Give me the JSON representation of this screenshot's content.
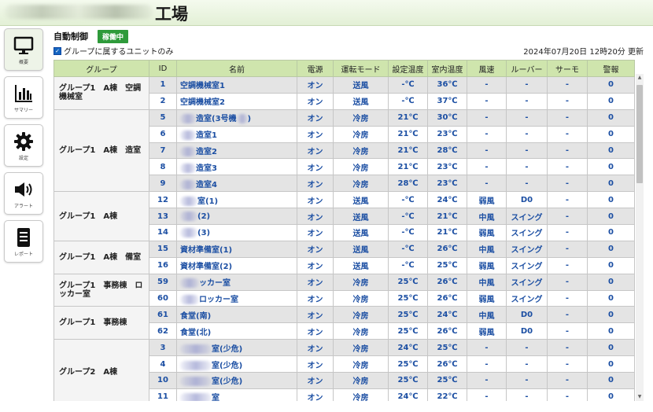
{
  "header": {
    "title": "工場"
  },
  "sidebar": [
    {
      "icon": "monitor-icon",
      "label": "概要"
    },
    {
      "icon": "bar-chart-icon",
      "label": "サマリー"
    },
    {
      "icon": "gear-icon",
      "label": "設定"
    },
    {
      "icon": "speaker-icon",
      "label": "アラート"
    },
    {
      "icon": "document-icon",
      "label": "レポート"
    }
  ],
  "page": {
    "title": "自動制御",
    "status": "稼働中",
    "filter_label": "グループに属するユニットのみ",
    "filter_checked": true,
    "updated": "2024年07月20日 12時20分 更新"
  },
  "columns": [
    "グループ",
    "ID",
    "名前",
    "電源",
    "運転モード",
    "設定温度",
    "室内温度",
    "風速",
    "ルーバー",
    "サーモ",
    "警報"
  ],
  "rows": [
    {
      "group": "グループ1　A棟　空調機械室",
      "span": 2,
      "id": "1",
      "name": "空調機械室1",
      "power": "オン",
      "mode": "送風",
      "set": "-℃",
      "room": "36℃",
      "fan": "-",
      "louver": "-",
      "thermo": "-",
      "alarm": "0"
    },
    {
      "id": "2",
      "name": "空調機械室2",
      "power": "オン",
      "mode": "送風",
      "set": "-℃",
      "room": "37℃",
      "fan": "-",
      "louver": "-",
      "thermo": "-",
      "alarm": "0"
    },
    {
      "group": "グループ1　A棟　造室",
      "span": 5,
      "id": "5",
      "name": "造室(3号機",
      "mask": 20,
      "tail": ")",
      "power": "オン",
      "mode": "冷房",
      "set": "21℃",
      "room": "30℃",
      "fan": "-",
      "louver": "-",
      "thermo": "-",
      "alarm": "0"
    },
    {
      "id": "6",
      "name": "造室1",
      "mask": 20,
      "power": "オン",
      "mode": "冷房",
      "set": "21℃",
      "room": "23℃",
      "fan": "-",
      "louver": "-",
      "thermo": "-",
      "alarm": "0"
    },
    {
      "id": "7",
      "name": "造室2",
      "mask": 20,
      "power": "オン",
      "mode": "冷房",
      "set": "21℃",
      "room": "28℃",
      "fan": "-",
      "louver": "-",
      "thermo": "-",
      "alarm": "0"
    },
    {
      "id": "8",
      "name": "造室3",
      "mask": 20,
      "power": "オン",
      "mode": "冷房",
      "set": "21℃",
      "room": "23℃",
      "fan": "-",
      "louver": "-",
      "thermo": "-",
      "alarm": "0"
    },
    {
      "id": "9",
      "name": "造室4",
      "mask": 20,
      "power": "オン",
      "mode": "冷房",
      "set": "28℃",
      "room": "23℃",
      "fan": "-",
      "louver": "-",
      "thermo": "-",
      "alarm": "0"
    },
    {
      "group": "グループ1　A棟",
      "span": 3,
      "id": "12",
      "name": "室(1)",
      "mask": 22,
      "power": "オン",
      "mode": "送風",
      "set": "-℃",
      "room": "24℃",
      "fan": "弱風",
      "louver": "D0",
      "thermo": "-",
      "alarm": "0"
    },
    {
      "id": "13",
      "name": "(2)",
      "mask": 22,
      "power": "オン",
      "mode": "送風",
      "set": "-℃",
      "room": "21℃",
      "fan": "中風",
      "louver": "スイング",
      "thermo": "-",
      "alarm": "0"
    },
    {
      "id": "14",
      "name": "(3)",
      "mask": 22,
      "power": "オン",
      "mode": "送風",
      "set": "-℃",
      "room": "21℃",
      "fan": "弱風",
      "louver": "スイング",
      "thermo": "-",
      "alarm": "0"
    },
    {
      "group": "グループ1　A棟　備室",
      "span": 2,
      "id": "15",
      "name": "資材準備室(1)",
      "power": "オン",
      "mode": "送風",
      "set": "-℃",
      "room": "26℃",
      "fan": "中風",
      "louver": "スイング",
      "thermo": "-",
      "alarm": "0"
    },
    {
      "id": "16",
      "name": "資材準備室(2)",
      "power": "オン",
      "mode": "送風",
      "set": "-℃",
      "room": "25℃",
      "fan": "弱風",
      "louver": "スイング",
      "thermo": "-",
      "alarm": "0"
    },
    {
      "group": "グループ1　事務棟　ロッカー室",
      "span": 2,
      "id": "59",
      "name": "ッカー室",
      "mask": 24,
      "power": "オン",
      "mode": "冷房",
      "set": "25℃",
      "room": "26℃",
      "fan": "中風",
      "louver": "スイング",
      "thermo": "-",
      "alarm": "0"
    },
    {
      "id": "60",
      "name": "ロッカー室",
      "mask": 24,
      "power": "オン",
      "mode": "冷房",
      "set": "25℃",
      "room": "26℃",
      "fan": "弱風",
      "louver": "スイング",
      "thermo": "-",
      "alarm": "0"
    },
    {
      "group": "グループ1　事務棟",
      "span": 2,
      "id": "61",
      "name": "食堂(南)",
      "power": "オン",
      "mode": "冷房",
      "set": "25℃",
      "room": "24℃",
      "fan": "中風",
      "louver": "D0",
      "thermo": "-",
      "alarm": "0"
    },
    {
      "id": "62",
      "name": "食堂(北)",
      "power": "オン",
      "mode": "冷房",
      "set": "25℃",
      "room": "26℃",
      "fan": "弱風",
      "louver": "D0",
      "thermo": "-",
      "alarm": "0"
    },
    {
      "group": "グループ2　A棟",
      "span": 4,
      "id": "3",
      "name": "室(少危)",
      "mask": 40,
      "power": "オン",
      "mode": "冷房",
      "set": "24℃",
      "room": "25℃",
      "fan": "-",
      "louver": "-",
      "thermo": "-",
      "alarm": "0"
    },
    {
      "id": "4",
      "name": "室(少危)",
      "mask": 40,
      "power": "オン",
      "mode": "冷房",
      "set": "25℃",
      "room": "26℃",
      "fan": "-",
      "louver": "-",
      "thermo": "-",
      "alarm": "0"
    },
    {
      "id": "10",
      "name": "室(少危)",
      "mask": 40,
      "power": "オン",
      "mode": "冷房",
      "set": "25℃",
      "room": "25℃",
      "fan": "-",
      "louver": "-",
      "thermo": "-",
      "alarm": "0"
    },
    {
      "id": "11",
      "name": "室",
      "mask": 40,
      "power": "オン",
      "mode": "冷房",
      "set": "24℃",
      "room": "22℃",
      "fan": "-",
      "louver": "-",
      "thermo": "-",
      "alarm": "0"
    }
  ]
}
